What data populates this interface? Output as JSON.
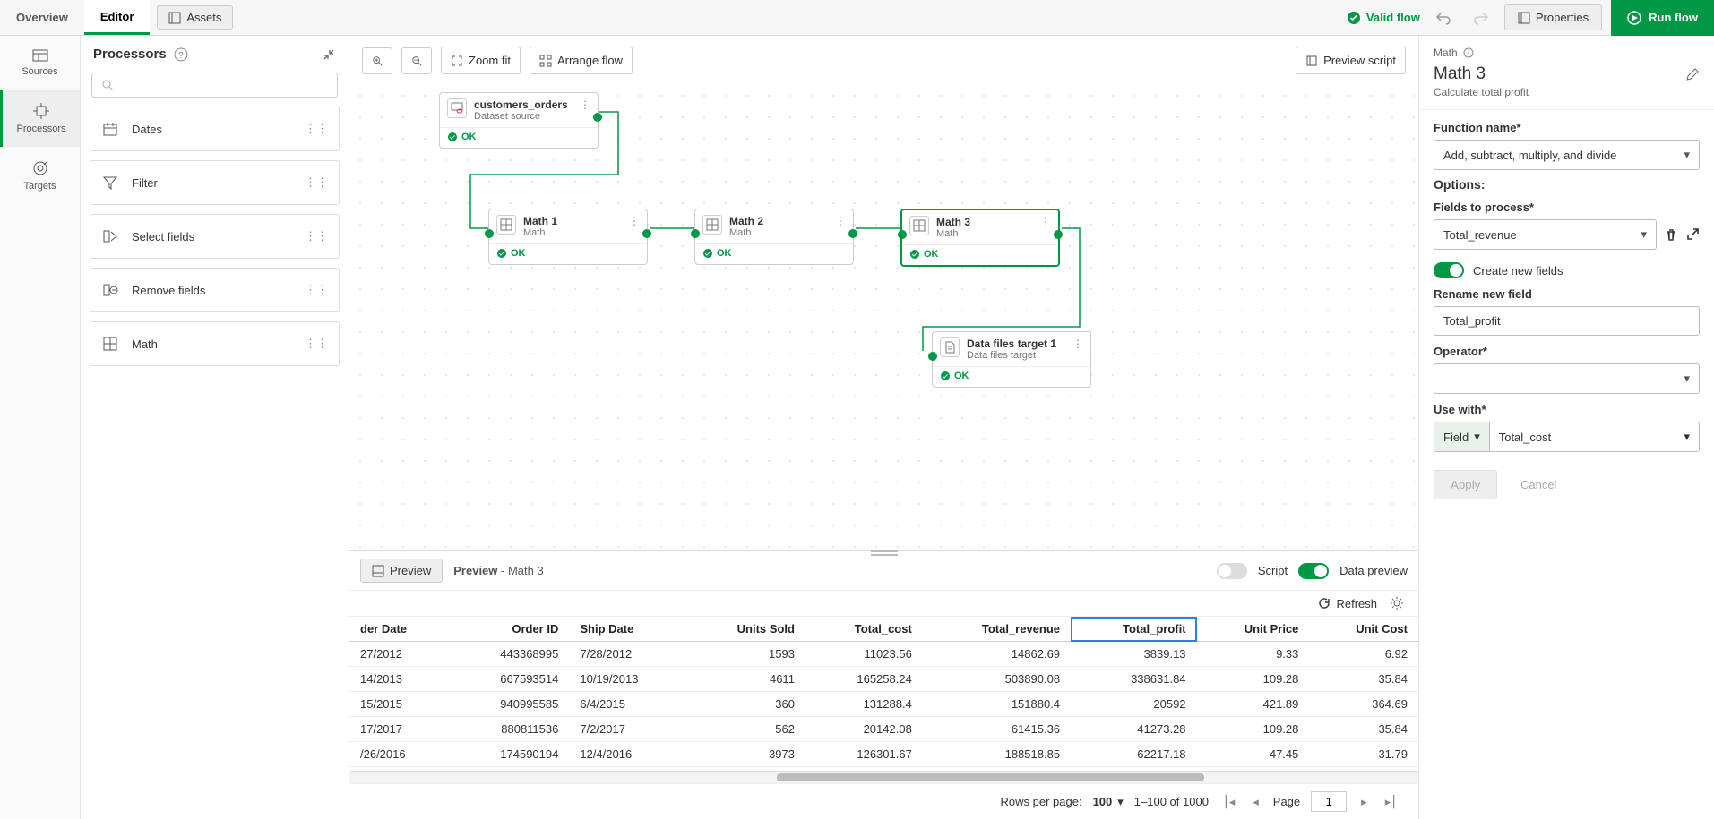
{
  "topbar": {
    "tabs": {
      "overview": "Overview",
      "editor": "Editor"
    },
    "assets": "Assets",
    "validflow": "Valid flow",
    "properties": "Properties",
    "run": "Run flow"
  },
  "sidenav": {
    "sources": "Sources",
    "processors": "Processors",
    "targets": "Targets"
  },
  "procpanel": {
    "title": "Processors",
    "items": [
      "Dates",
      "Filter",
      "Select fields",
      "Remove fields",
      "Math"
    ]
  },
  "canvasTools": {
    "zoomfit": "Zoom fit",
    "arrange": "Arrange flow",
    "preview": "Preview script"
  },
  "nodes": {
    "n1": {
      "title": "customers_orders",
      "sub": "Dataset source",
      "status": "OK"
    },
    "n2": {
      "title": "Math 1",
      "sub": "Math",
      "status": "OK"
    },
    "n3": {
      "title": "Math 2",
      "sub": "Math",
      "status": "OK"
    },
    "n4": {
      "title": "Math 3",
      "sub": "Math",
      "status": "OK"
    },
    "n5": {
      "title": "Data files target 1",
      "sub": "Data files target",
      "status": "OK"
    }
  },
  "preview": {
    "btn": "Preview",
    "title": "Preview",
    "subtitle": "- Math 3",
    "script": "Script",
    "datapreview": "Data preview",
    "refresh": "Refresh",
    "headers": [
      "der Date",
      "Order ID",
      "Ship Date",
      "Units Sold",
      "Total_cost",
      "Total_revenue",
      "Total_profit",
      "Unit Price",
      "Unit Cost"
    ],
    "rows": [
      [
        "27/2012",
        "443368995",
        "7/28/2012",
        "1593",
        "11023.56",
        "14862.69",
        "3839.13",
        "9.33",
        "6.92"
      ],
      [
        "14/2013",
        "667593514",
        "10/19/2013",
        "4611",
        "165258.24",
        "503890.08",
        "338631.84",
        "109.28",
        "35.84"
      ],
      [
        "15/2015",
        "940995585",
        "6/4/2015",
        "360",
        "131288.4",
        "151880.4",
        "20592",
        "421.89",
        "364.69"
      ],
      [
        "17/2017",
        "880811536",
        "7/2/2017",
        "562",
        "20142.08",
        "61415.36",
        "41273.28",
        "109.28",
        "35.84"
      ],
      [
        "/26/2016",
        "174590194",
        "12/4/2016",
        "3973",
        "126301.67",
        "188518.85",
        "62217.18",
        "47.45",
        "31.79"
      ]
    ],
    "pager": {
      "rpp": "Rows per page:",
      "rpp_val": "100",
      "range": "1–100 of 1000",
      "page_lbl": "Page",
      "page_val": "1"
    }
  },
  "props": {
    "crumb": "Math",
    "title": "Math 3",
    "sub": "Calculate total profit",
    "fn_label": "Function name*",
    "fn_value": "Add, subtract, multiply, and divide",
    "options": "Options:",
    "fields_label": "Fields to process*",
    "fields_value": "Total_revenue",
    "createnew": "Create new fields",
    "rename_label": "Rename new field",
    "rename_value": "Total_profit",
    "operator_label": "Operator*",
    "operator_value": "-",
    "usewith_label": "Use with*",
    "usewith_type": "Field",
    "usewith_value": "Total_cost",
    "apply": "Apply",
    "cancel": "Cancel"
  }
}
